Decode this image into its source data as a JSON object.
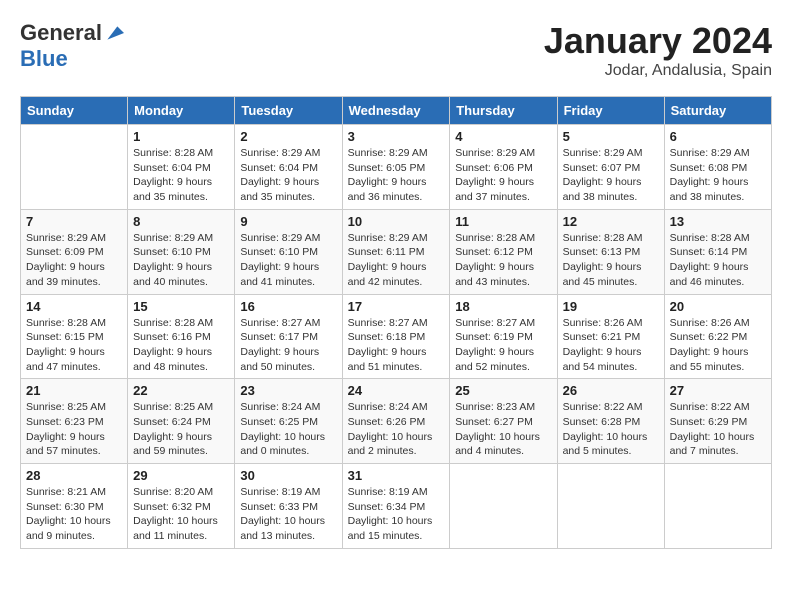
{
  "header": {
    "logo_general": "General",
    "logo_blue": "Blue",
    "month": "January 2024",
    "location": "Jodar, Andalusia, Spain"
  },
  "days_of_week": [
    "Sunday",
    "Monday",
    "Tuesday",
    "Wednesday",
    "Thursday",
    "Friday",
    "Saturday"
  ],
  "weeks": [
    [
      {
        "day": "",
        "sunrise": "",
        "sunset": "",
        "daylight": ""
      },
      {
        "day": "1",
        "sunrise": "Sunrise: 8:28 AM",
        "sunset": "Sunset: 6:04 PM",
        "daylight": "Daylight: 9 hours and 35 minutes."
      },
      {
        "day": "2",
        "sunrise": "Sunrise: 8:29 AM",
        "sunset": "Sunset: 6:04 PM",
        "daylight": "Daylight: 9 hours and 35 minutes."
      },
      {
        "day": "3",
        "sunrise": "Sunrise: 8:29 AM",
        "sunset": "Sunset: 6:05 PM",
        "daylight": "Daylight: 9 hours and 36 minutes."
      },
      {
        "day": "4",
        "sunrise": "Sunrise: 8:29 AM",
        "sunset": "Sunset: 6:06 PM",
        "daylight": "Daylight: 9 hours and 37 minutes."
      },
      {
        "day": "5",
        "sunrise": "Sunrise: 8:29 AM",
        "sunset": "Sunset: 6:07 PM",
        "daylight": "Daylight: 9 hours and 38 minutes."
      },
      {
        "day": "6",
        "sunrise": "Sunrise: 8:29 AM",
        "sunset": "Sunset: 6:08 PM",
        "daylight": "Daylight: 9 hours and 38 minutes."
      }
    ],
    [
      {
        "day": "7",
        "sunrise": "Sunrise: 8:29 AM",
        "sunset": "Sunset: 6:09 PM",
        "daylight": "Daylight: 9 hours and 39 minutes."
      },
      {
        "day": "8",
        "sunrise": "Sunrise: 8:29 AM",
        "sunset": "Sunset: 6:10 PM",
        "daylight": "Daylight: 9 hours and 40 minutes."
      },
      {
        "day": "9",
        "sunrise": "Sunrise: 8:29 AM",
        "sunset": "Sunset: 6:10 PM",
        "daylight": "Daylight: 9 hours and 41 minutes."
      },
      {
        "day": "10",
        "sunrise": "Sunrise: 8:29 AM",
        "sunset": "Sunset: 6:11 PM",
        "daylight": "Daylight: 9 hours and 42 minutes."
      },
      {
        "day": "11",
        "sunrise": "Sunrise: 8:28 AM",
        "sunset": "Sunset: 6:12 PM",
        "daylight": "Daylight: 9 hours and 43 minutes."
      },
      {
        "day": "12",
        "sunrise": "Sunrise: 8:28 AM",
        "sunset": "Sunset: 6:13 PM",
        "daylight": "Daylight: 9 hours and 45 minutes."
      },
      {
        "day": "13",
        "sunrise": "Sunrise: 8:28 AM",
        "sunset": "Sunset: 6:14 PM",
        "daylight": "Daylight: 9 hours and 46 minutes."
      }
    ],
    [
      {
        "day": "14",
        "sunrise": "Sunrise: 8:28 AM",
        "sunset": "Sunset: 6:15 PM",
        "daylight": "Daylight: 9 hours and 47 minutes."
      },
      {
        "day": "15",
        "sunrise": "Sunrise: 8:28 AM",
        "sunset": "Sunset: 6:16 PM",
        "daylight": "Daylight: 9 hours and 48 minutes."
      },
      {
        "day": "16",
        "sunrise": "Sunrise: 8:27 AM",
        "sunset": "Sunset: 6:17 PM",
        "daylight": "Daylight: 9 hours and 50 minutes."
      },
      {
        "day": "17",
        "sunrise": "Sunrise: 8:27 AM",
        "sunset": "Sunset: 6:18 PM",
        "daylight": "Daylight: 9 hours and 51 minutes."
      },
      {
        "day": "18",
        "sunrise": "Sunrise: 8:27 AM",
        "sunset": "Sunset: 6:19 PM",
        "daylight": "Daylight: 9 hours and 52 minutes."
      },
      {
        "day": "19",
        "sunrise": "Sunrise: 8:26 AM",
        "sunset": "Sunset: 6:21 PM",
        "daylight": "Daylight: 9 hours and 54 minutes."
      },
      {
        "day": "20",
        "sunrise": "Sunrise: 8:26 AM",
        "sunset": "Sunset: 6:22 PM",
        "daylight": "Daylight: 9 hours and 55 minutes."
      }
    ],
    [
      {
        "day": "21",
        "sunrise": "Sunrise: 8:25 AM",
        "sunset": "Sunset: 6:23 PM",
        "daylight": "Daylight: 9 hours and 57 minutes."
      },
      {
        "day": "22",
        "sunrise": "Sunrise: 8:25 AM",
        "sunset": "Sunset: 6:24 PM",
        "daylight": "Daylight: 9 hours and 59 minutes."
      },
      {
        "day": "23",
        "sunrise": "Sunrise: 8:24 AM",
        "sunset": "Sunset: 6:25 PM",
        "daylight": "Daylight: 10 hours and 0 minutes."
      },
      {
        "day": "24",
        "sunrise": "Sunrise: 8:24 AM",
        "sunset": "Sunset: 6:26 PM",
        "daylight": "Daylight: 10 hours and 2 minutes."
      },
      {
        "day": "25",
        "sunrise": "Sunrise: 8:23 AM",
        "sunset": "Sunset: 6:27 PM",
        "daylight": "Daylight: 10 hours and 4 minutes."
      },
      {
        "day": "26",
        "sunrise": "Sunrise: 8:22 AM",
        "sunset": "Sunset: 6:28 PM",
        "daylight": "Daylight: 10 hours and 5 minutes."
      },
      {
        "day": "27",
        "sunrise": "Sunrise: 8:22 AM",
        "sunset": "Sunset: 6:29 PM",
        "daylight": "Daylight: 10 hours and 7 minutes."
      }
    ],
    [
      {
        "day": "28",
        "sunrise": "Sunrise: 8:21 AM",
        "sunset": "Sunset: 6:30 PM",
        "daylight": "Daylight: 10 hours and 9 minutes."
      },
      {
        "day": "29",
        "sunrise": "Sunrise: 8:20 AM",
        "sunset": "Sunset: 6:32 PM",
        "daylight": "Daylight: 10 hours and 11 minutes."
      },
      {
        "day": "30",
        "sunrise": "Sunrise: 8:19 AM",
        "sunset": "Sunset: 6:33 PM",
        "daylight": "Daylight: 10 hours and 13 minutes."
      },
      {
        "day": "31",
        "sunrise": "Sunrise: 8:19 AM",
        "sunset": "Sunset: 6:34 PM",
        "daylight": "Daylight: 10 hours and 15 minutes."
      },
      {
        "day": "",
        "sunrise": "",
        "sunset": "",
        "daylight": ""
      },
      {
        "day": "",
        "sunrise": "",
        "sunset": "",
        "daylight": ""
      },
      {
        "day": "",
        "sunrise": "",
        "sunset": "",
        "daylight": ""
      }
    ]
  ]
}
